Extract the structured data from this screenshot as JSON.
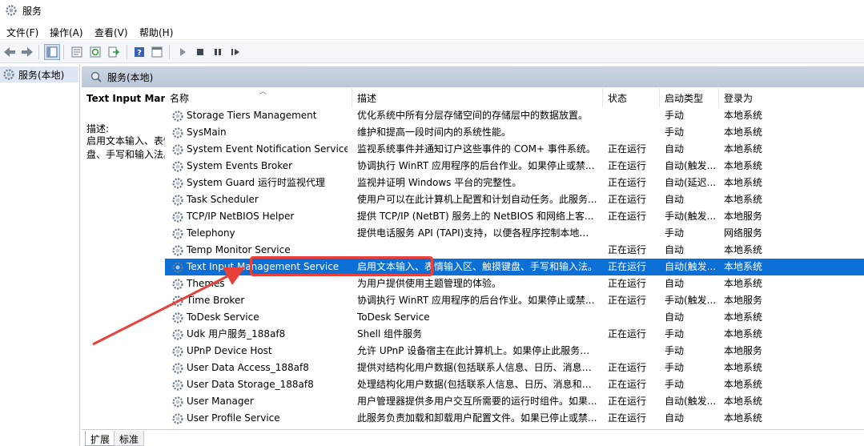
{
  "window": {
    "title": "服务"
  },
  "menu": [
    "文件(F)",
    "操作(A)",
    "查看(V)",
    "帮助(H)"
  ],
  "tree": {
    "root_label": "服务(本地)"
  },
  "pane_header": "服务(本地)",
  "details": {
    "service_name": "Text Input Management Service",
    "desc_label": "描述:",
    "desc_text": "启用文本输入、表情输入区、触摸键盘、手写和输入法。"
  },
  "columns": {
    "name": "名称",
    "desc": "描述",
    "state": "状态",
    "start": "启动类型",
    "logon": "登录为"
  },
  "rows": [
    {
      "name": "Storage Tiers Management",
      "desc": "优化系统中所有分层存储空间的存储层中的数据放置。",
      "state": "",
      "start": "手动",
      "logon": "本地系统"
    },
    {
      "name": "SysMain",
      "desc": "维护和提高一段时间内的系统性能。",
      "state": "",
      "start": "手动",
      "logon": "本地系统"
    },
    {
      "name": "System Event Notification Service",
      "desc": "监视系统事件并通知订户这些事件的 COM+ 事件系统。",
      "state": "正在运行",
      "start": "自动",
      "logon": "本地系统"
    },
    {
      "name": "System Events Broker",
      "desc": "协调执行 WinRT 应用程序的后台作业。如果停止或禁...",
      "state": "正在运行",
      "start": "自动(触发...",
      "logon": "本地系统"
    },
    {
      "name": "System Guard 运行时监视代理",
      "desc": "监视并证明 Windows 平台的完整性。",
      "state": "正在运行",
      "start": "自动(延迟...",
      "logon": "本地系统"
    },
    {
      "name": "Task Scheduler",
      "desc": "使用户可以在此计算机上配置和计划自动任务。此服务...",
      "state": "正在运行",
      "start": "自动",
      "logon": "本地系统"
    },
    {
      "name": "TCP/IP NetBIOS Helper",
      "desc": "提供 TCP/IP (NetBT) 服务上的 NetBIOS 和网络上客...",
      "state": "正在运行",
      "start": "手动(触发...",
      "logon": "本地服务"
    },
    {
      "name": "Telephony",
      "desc": "提供电话服务 API (TAPI)支持，以便各程序控制本地计...",
      "state": "",
      "start": "手动",
      "logon": "网络服务"
    },
    {
      "name": "Temp Monitor Service",
      "desc": "",
      "state": "正在运行",
      "start": "自动",
      "logon": "本地系统"
    },
    {
      "name": "Text Input Management Service",
      "desc": "启用文本输入、表情输入区、触摸键盘、手写和输入法。",
      "state": "正在运行",
      "start": "自动(触发...",
      "logon": "本地系统",
      "selected": true
    },
    {
      "name": "Themes",
      "desc": "为用户提供使用主题管理的体验。",
      "state": "正在运行",
      "start": "自动",
      "logon": "本地系统"
    },
    {
      "name": "Time Broker",
      "desc": "协调执行 WinRT 应用程序的后台作业。如果停止或禁...",
      "state": "正在运行",
      "start": "手动(触发...",
      "logon": "本地服务"
    },
    {
      "name": "ToDesk Service",
      "desc": "ToDesk Service",
      "state": "",
      "start": "自动",
      "logon": "本地系统"
    },
    {
      "name": "Udk 用户服务_188af8",
      "desc": "Shell 组件服务",
      "state": "正在运行",
      "start": "手动",
      "logon": "本地系统"
    },
    {
      "name": "UPnP Device Host",
      "desc": "允许 UPnP 设备宿主在此计算机上。如果停止此服务，...",
      "state": "",
      "start": "手动",
      "logon": "本地服务"
    },
    {
      "name": "User Data Access_188af8",
      "desc": "提供对结构化用户数据(包括联系人信息、日历、消息和...",
      "state": "正在运行",
      "start": "手动",
      "logon": "本地系统"
    },
    {
      "name": "User Data Storage_188af8",
      "desc": "处理结构化用户数据(包括联系人信息、日历、消息和其...",
      "state": "正在运行",
      "start": "手动",
      "logon": "本地系统"
    },
    {
      "name": "User Manager",
      "desc": "用户管理器提供多用户交互所需要的运行时组件。如果...",
      "state": "正在运行",
      "start": "自动(触发...",
      "logon": "本地系统"
    },
    {
      "name": "User Profile Service",
      "desc": "此服务负责加载和卸载用户配置文件。如果已停止或禁...",
      "state": "正在运行",
      "start": "自动",
      "logon": "本地系统"
    }
  ],
  "tabs": [
    "扩展",
    "标准"
  ],
  "colors": {
    "selection": "#0c6fd6",
    "annotation": "#e8403a",
    "header": "#c3cfde"
  }
}
